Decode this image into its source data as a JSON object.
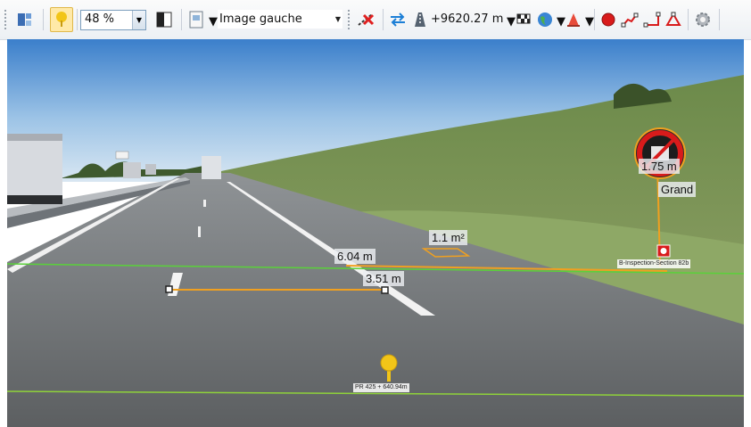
{
  "toolbar": {
    "zoom_value": "48 %",
    "image_select_value": "Image gauche",
    "distance_value": "+9620.27 m",
    "icons": [
      "layout-icon",
      "pin-tool-icon",
      "brightness-icon",
      "image-settings-icon",
      "remove-measure-icon",
      "swap-direction-icon",
      "road-distance-icon",
      "checkered-flag-icon",
      "globe-icon",
      "cone-icon",
      "record-icon",
      "polyline-icon",
      "angle-icon",
      "triangle-icon",
      "settings-icon"
    ]
  },
  "scene": {
    "labels": {
      "width_6": "6.04 m",
      "width_3": "3.51 m",
      "area": "1.1 m²",
      "sign_height": "1.75 m",
      "sign_size": "Grand",
      "inspection": "B-Inspection-Section 82b",
      "pin": "PR 425 + 640.94m"
    },
    "colors": {
      "measure_line": "#f0a020",
      "horizon_line": "#5ad13a",
      "pin": "#f2c518",
      "sign_red": "#d81b1b"
    }
  }
}
